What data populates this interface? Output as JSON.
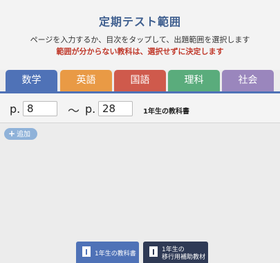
{
  "header": {
    "title": "定期テスト範囲",
    "instruction": "ページを入力するか、目次をタップして、出題範囲を選択します",
    "warning": "範囲が分からない教科は、選択せずに決定します"
  },
  "tabs": [
    {
      "label": "数学",
      "color": "#4f72b7",
      "active": true
    },
    {
      "label": "英語",
      "color": "#e99a45"
    },
    {
      "label": "国語",
      "color": "#cf5a4c"
    },
    {
      "label": "理科",
      "color": "#5aac7c"
    },
    {
      "label": "社会",
      "color": "#9a86bd"
    }
  ],
  "range": {
    "from_prefix": "p.",
    "from_value": "8",
    "separator": "～",
    "to_prefix": "p.",
    "to_value": "28",
    "book": "1年生の教科書"
  },
  "add_button": {
    "icon": "plus-icon",
    "label": "追加"
  },
  "footer": {
    "textbook_button": {
      "icon": "book-icon",
      "label": "1年生の教科書",
      "color": "#4f72b7"
    },
    "transition_button": {
      "icon": "book-icon",
      "line1": "1年生の",
      "line2": "移行用補助教材",
      "color": "#2f3a55"
    }
  }
}
